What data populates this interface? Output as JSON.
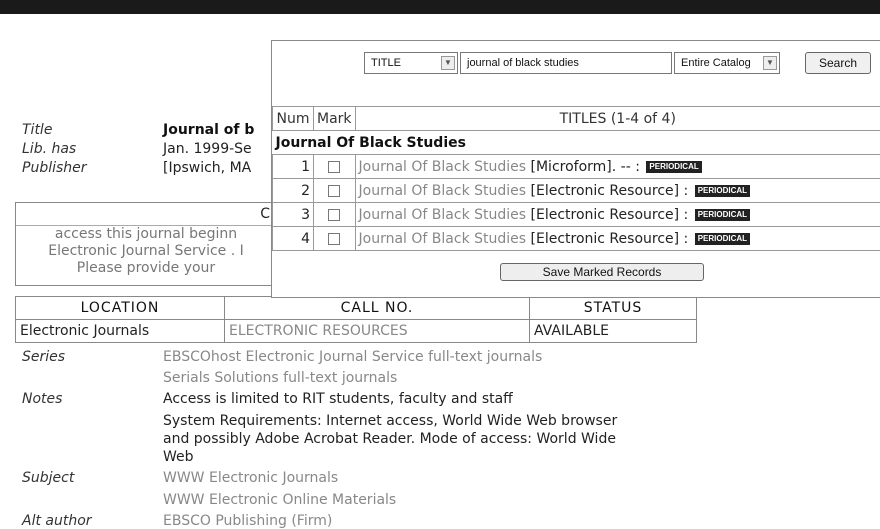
{
  "record": {
    "title_label": "Title",
    "title_value": "Journal of b",
    "libhas_label": "Lib. has",
    "libhas_value": "Jan. 1999-Se",
    "publisher_label": "Publisher",
    "publisher_value": "[Ipswich, MA",
    "holdings_head": "C",
    "holdings_lines": [
      "access this journal beginn",
      "Electronic Journal Service . I",
      "Please provide your"
    ]
  },
  "location_table": {
    "headers": [
      "LOCATION",
      "CALL NO.",
      "STATUS"
    ],
    "row": [
      "Electronic Journals",
      "ELECTRONIC RESOURCES",
      "AVAILABLE"
    ]
  },
  "details": {
    "series_label": "Series",
    "series_values": [
      "EBSCOhost Electronic Journal Service full-text journals",
      "Serials Solutions full-text journals"
    ],
    "notes_label": "Notes",
    "notes_values": [
      "Access is limited to RIT students, faculty and staff",
      "System Requirements: Internet access, World Wide Web browser",
      "and possibly Adobe Acrobat Reader. Mode of access: World Wide",
      "Web"
    ],
    "subject_label": "Subject",
    "subject_values": [
      "WWW Electronic Journals",
      "WWW Electronic Online Materials"
    ],
    "altauthor_label": "Alt author",
    "altauthor_value": "EBSCO Publishing (Firm)"
  },
  "search": {
    "field_select": "TITLE",
    "query": "journal of black studies",
    "scope_select": "Entire Catalog",
    "button": "Search"
  },
  "titles": {
    "col_num": "Num",
    "col_mark": "Mark",
    "col_titles": "TITLES (1-4 of 4)",
    "group": "Journal Of Black Studies",
    "rows": [
      {
        "num": "1",
        "title": "Journal Of Black Studies",
        "suffix": " [Microform]. -- :",
        "badge": "PERIODICAL"
      },
      {
        "num": "2",
        "title": "Journal Of Black Studies",
        "suffix": " [Electronic Resource] :",
        "badge": "PERIODICAL"
      },
      {
        "num": "3",
        "title": "Journal Of Black Studies",
        "suffix": " [Electronic Resource] :",
        "badge": "PERIODICAL"
      },
      {
        "num": "4",
        "title": "Journal Of Black Studies",
        "suffix": " [Electronic Resource] :",
        "badge": "PERIODICAL"
      }
    ],
    "save_button": "Save Marked Records"
  }
}
